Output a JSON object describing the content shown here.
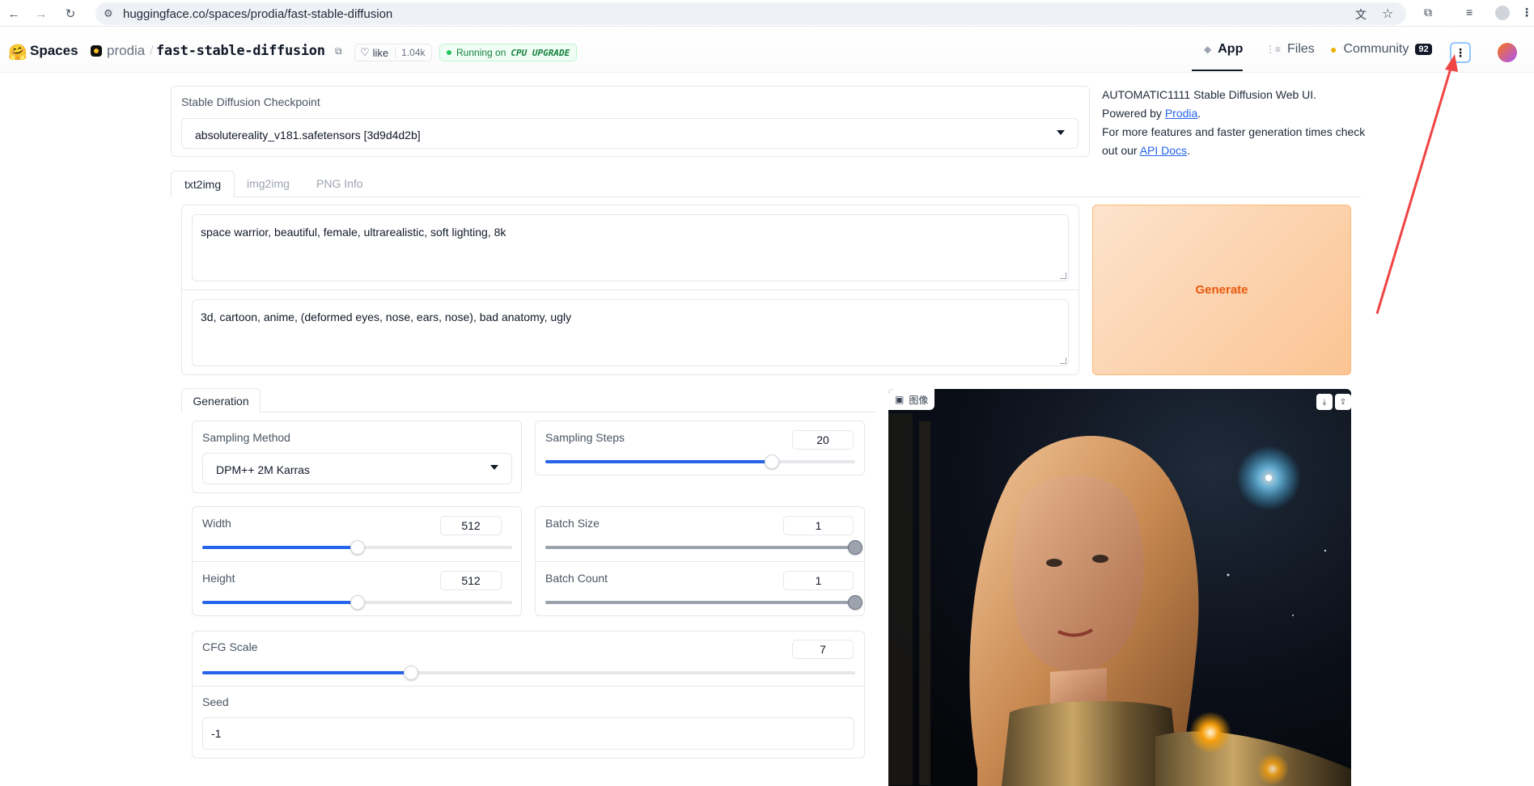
{
  "browser": {
    "url": "huggingface.co/spaces/prodia/fast-stable-diffusion"
  },
  "header": {
    "brand": "Spaces",
    "org": "prodia",
    "space_name": "fast-stable-diffusion",
    "like_label": "like",
    "like_count": "1.04k",
    "status_prefix": "Running on",
    "status_hw": "CPU UPGRADE",
    "tabs": [
      {
        "label": "App",
        "icon": "cube-icon",
        "active": true
      },
      {
        "label": "Files",
        "icon": "files-icon"
      },
      {
        "label": "Community",
        "icon": "community-icon",
        "count": "92"
      }
    ]
  },
  "checkpoint": {
    "label": "Stable Diffusion Checkpoint",
    "value": "absolutereality_v181.safetensors [3d9d4d2b]"
  },
  "info": {
    "line1": "AUTOMATIC1111 Stable Diffusion Web UI.",
    "line2_prefix": "Powered by ",
    "line2_link": "Prodia",
    "line2_suffix": ".",
    "line3": "For more features and faster generation times check",
    "line4_prefix": "out our ",
    "line4_link": "API Docs",
    "line4_suffix": "."
  },
  "main_tabs": [
    "txt2img",
    "img2img",
    "PNG Info"
  ],
  "prompt": "space warrior, beautiful, female, ultrarealistic, soft lighting, 8k",
  "negative_prompt": "3d, cartoon, anime, (deformed eyes, nose, ears, nose), bad anatomy, ugly",
  "generate_label": "Generate",
  "generation_tab": "Generation",
  "sampling_method": {
    "label": "Sampling Method",
    "value": "DPM++ 2M Karras"
  },
  "sampling_steps": {
    "label": "Sampling Steps",
    "value": "20",
    "fraction": 0.73
  },
  "width": {
    "label": "Width",
    "value": "512",
    "fraction": 0.5
  },
  "height": {
    "label": "Height",
    "value": "512",
    "fraction": 0.5
  },
  "batch_size": {
    "label": "Batch Size",
    "value": "1",
    "fraction": 1.0
  },
  "batch_count": {
    "label": "Batch Count",
    "value": "1",
    "fraction": 1.0
  },
  "cfg_scale": {
    "label": "CFG Scale",
    "value": "7",
    "fraction": 0.32
  },
  "seed": {
    "label": "Seed",
    "value": "-1"
  },
  "output": {
    "label": "图像"
  },
  "colors": {
    "accent": "#2563eb",
    "generate": "#ea580c",
    "annotation": "#ef4444"
  }
}
